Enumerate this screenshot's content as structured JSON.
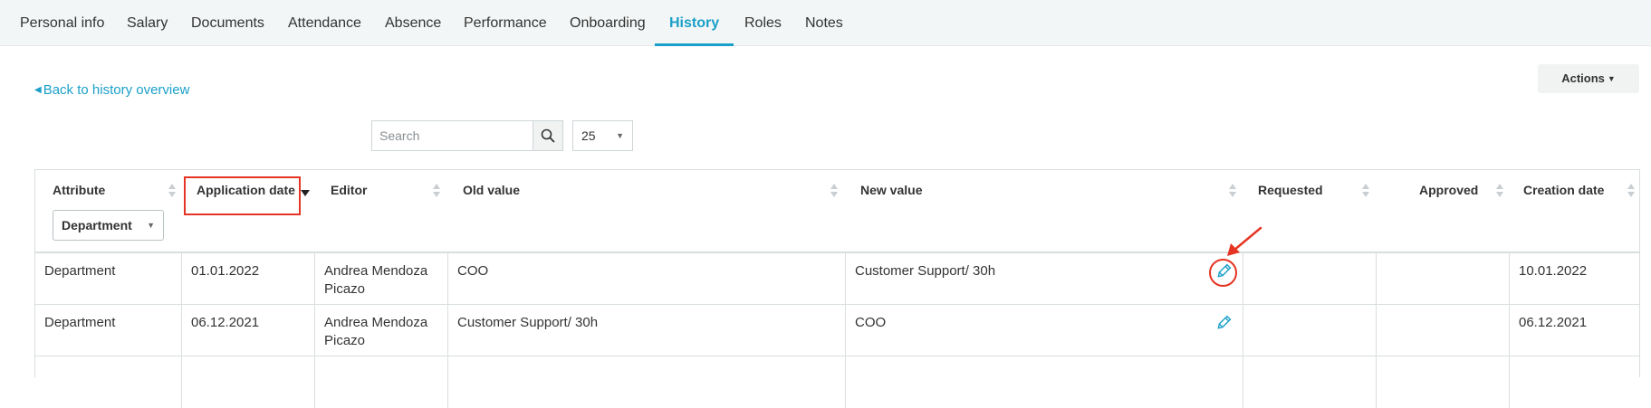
{
  "tabs": [
    {
      "label": "Personal info",
      "active": false
    },
    {
      "label": "Salary",
      "active": false
    },
    {
      "label": "Documents",
      "active": false
    },
    {
      "label": "Attendance",
      "active": false
    },
    {
      "label": "Absence",
      "active": false
    },
    {
      "label": "Performance",
      "active": false
    },
    {
      "label": "Onboarding",
      "active": false
    },
    {
      "label": "History",
      "active": true
    },
    {
      "label": "Roles",
      "active": false
    },
    {
      "label": "Notes",
      "active": false
    }
  ],
  "back_link": "Back to history overview",
  "actions_label": "Actions",
  "search": {
    "placeholder": "Search",
    "value": ""
  },
  "per_page": "25",
  "table": {
    "columns": [
      "Attribute",
      "Application date",
      "Editor",
      "Old value",
      "New value",
      "Requested",
      "Approved",
      "Creation date"
    ],
    "attribute_filter": "Department",
    "rows": [
      {
        "attribute": "Department",
        "application_date": "01.01.2022",
        "editor": "Andrea Mendoza Picazo",
        "old_value": "COO",
        "new_value": "Customer Support/ 30h",
        "requested": "",
        "approved": "",
        "creation_date": "10.01.2022"
      },
      {
        "attribute": "Department",
        "application_date": "06.12.2021",
        "editor": "Andrea Mendoza Picazo",
        "old_value": "Customer Support/ 30h",
        "new_value": "COO",
        "requested": "",
        "approved": "",
        "creation_date": "06.12.2021"
      }
    ]
  },
  "colors": {
    "accent": "#1aa0c8",
    "annotation": "#e53423",
    "tabbar_bg": "#f3f6f6"
  },
  "icons": {
    "search": "search-icon",
    "edit": "pencil-icon",
    "caret": "caret-down-icon"
  }
}
